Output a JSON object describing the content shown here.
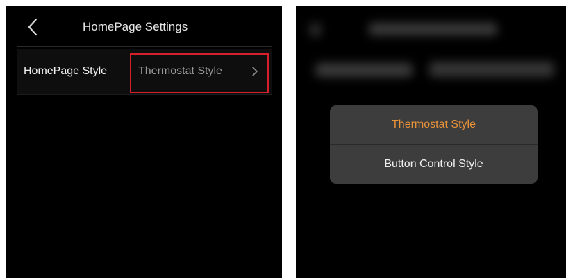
{
  "left_screen": {
    "header": {
      "title": "HomePage Settings",
      "back_icon": "chevron-left-icon"
    },
    "setting_row": {
      "label": "HomePage Style",
      "value": "Thermostat Style",
      "chevron_icon": "chevron-right-icon",
      "highlight_color": "#d5202b"
    }
  },
  "right_screen": {
    "popup": {
      "options": [
        {
          "label": "Thermostat Style",
          "selected": true,
          "color": "#e8923a"
        },
        {
          "label": "Button Control Style",
          "selected": false,
          "color": "#f0f0f0"
        }
      ]
    }
  },
  "colors": {
    "background": "#000000",
    "selected_accent": "#e8923a",
    "highlight_border": "#d5202b",
    "popup_background": "#3d3d3d"
  }
}
